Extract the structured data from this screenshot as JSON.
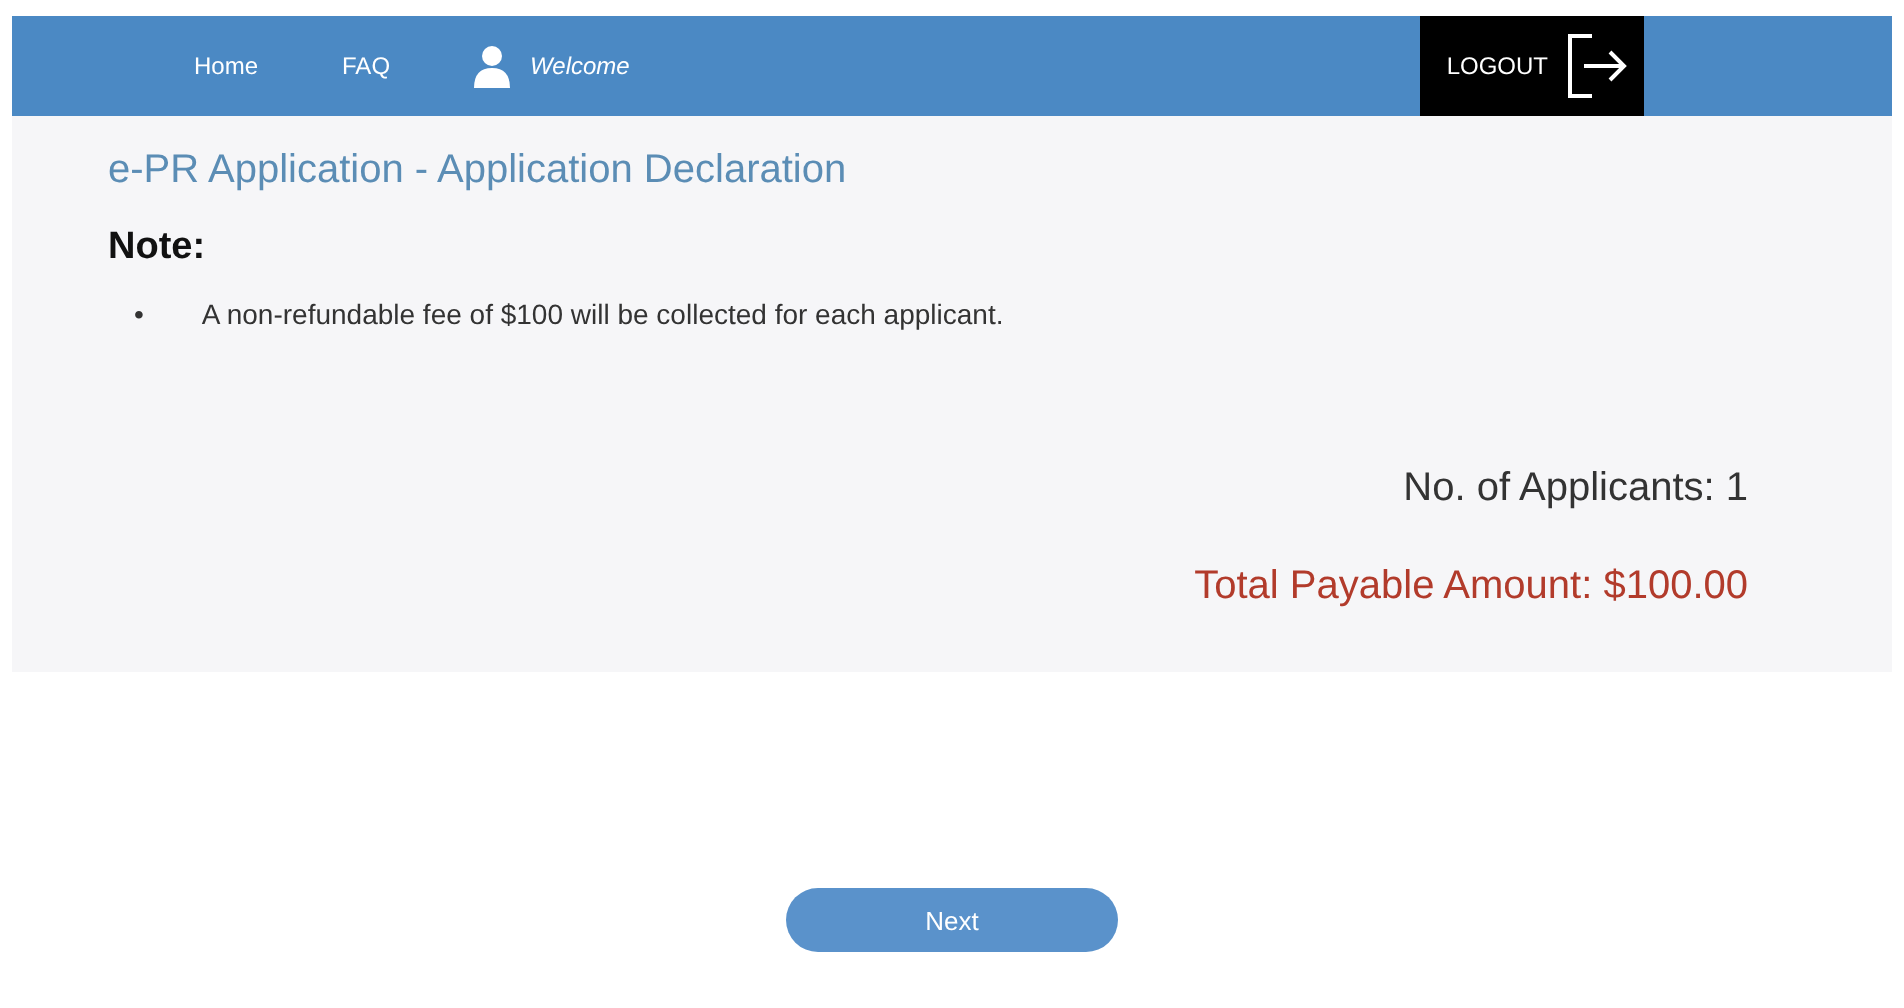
{
  "nav": {
    "links": [
      "Home",
      "FAQ"
    ],
    "user": "Welcome",
    "logout": "LOGOUT"
  },
  "page": {
    "title": "e-PR Application - Application Declaration",
    "note_heading": "Note:",
    "notes": [
      {
        "bullet": "•",
        "text": "A non-refundable fee of $100 will be collected for each applicant."
      }
    ],
    "applicants": "No. of Applicants: 1",
    "total": "Total Payable Amount: $100.00"
  },
  "buttons": [
    "Next"
  ]
}
